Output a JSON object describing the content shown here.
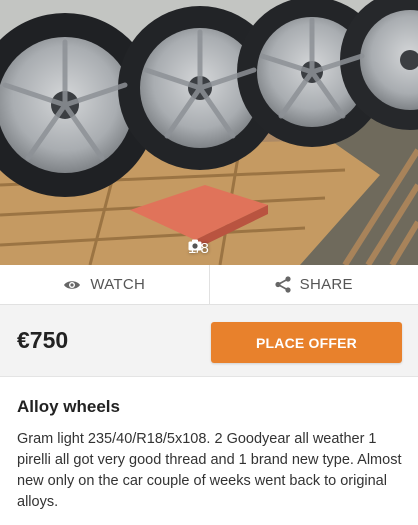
{
  "listing": {
    "photo_counter": "1/8",
    "price": "€750",
    "title": "Alloy wheels",
    "description": "Gram light 235/40/R18/5x108. 2 Goodyear all weather 1 pirelli all got very good thread and 1 brand new type. Almost new only on the car couple of weeks went back to original alloys."
  },
  "actions": {
    "watch_label": "WATCH",
    "watch_icon": "eye-icon",
    "share_label": "SHARE",
    "share_icon": "share-icon"
  },
  "offer": {
    "button_label": "PLACE OFFER"
  },
  "colors": {
    "accent": "#e8812c",
    "price_bg": "#f3f3f3"
  }
}
